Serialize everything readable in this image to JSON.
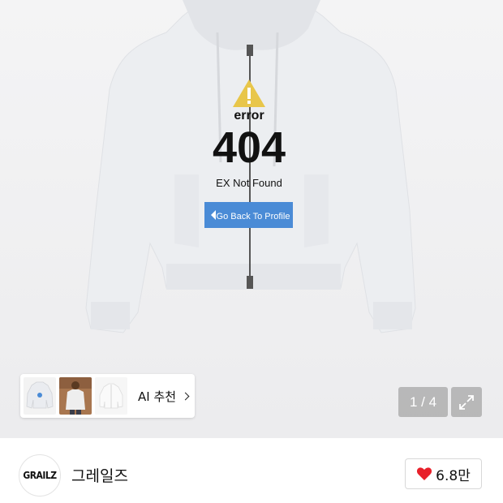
{
  "product_image": {
    "print": {
      "error_word": "error",
      "code": "404",
      "subtitle": "EX Not Found",
      "button_text": "Go Back To Profile"
    }
  },
  "ai_recommend": {
    "label": "AI 추천",
    "thumbnails": [
      "white-hoodie-thumb",
      "person-wearing-hoodie-thumb",
      "white-jacket-thumb"
    ]
  },
  "gallery": {
    "counter": "1 / 4"
  },
  "seller": {
    "logo_text": "GRAILZ",
    "name": "그레일즈"
  },
  "like": {
    "count": "6.8만",
    "color": "#e8202a"
  },
  "colors": {
    "hoodie": "#e9ebef",
    "print_blue": "#4a8bd6",
    "warning_yellow": "#e8c64a"
  }
}
